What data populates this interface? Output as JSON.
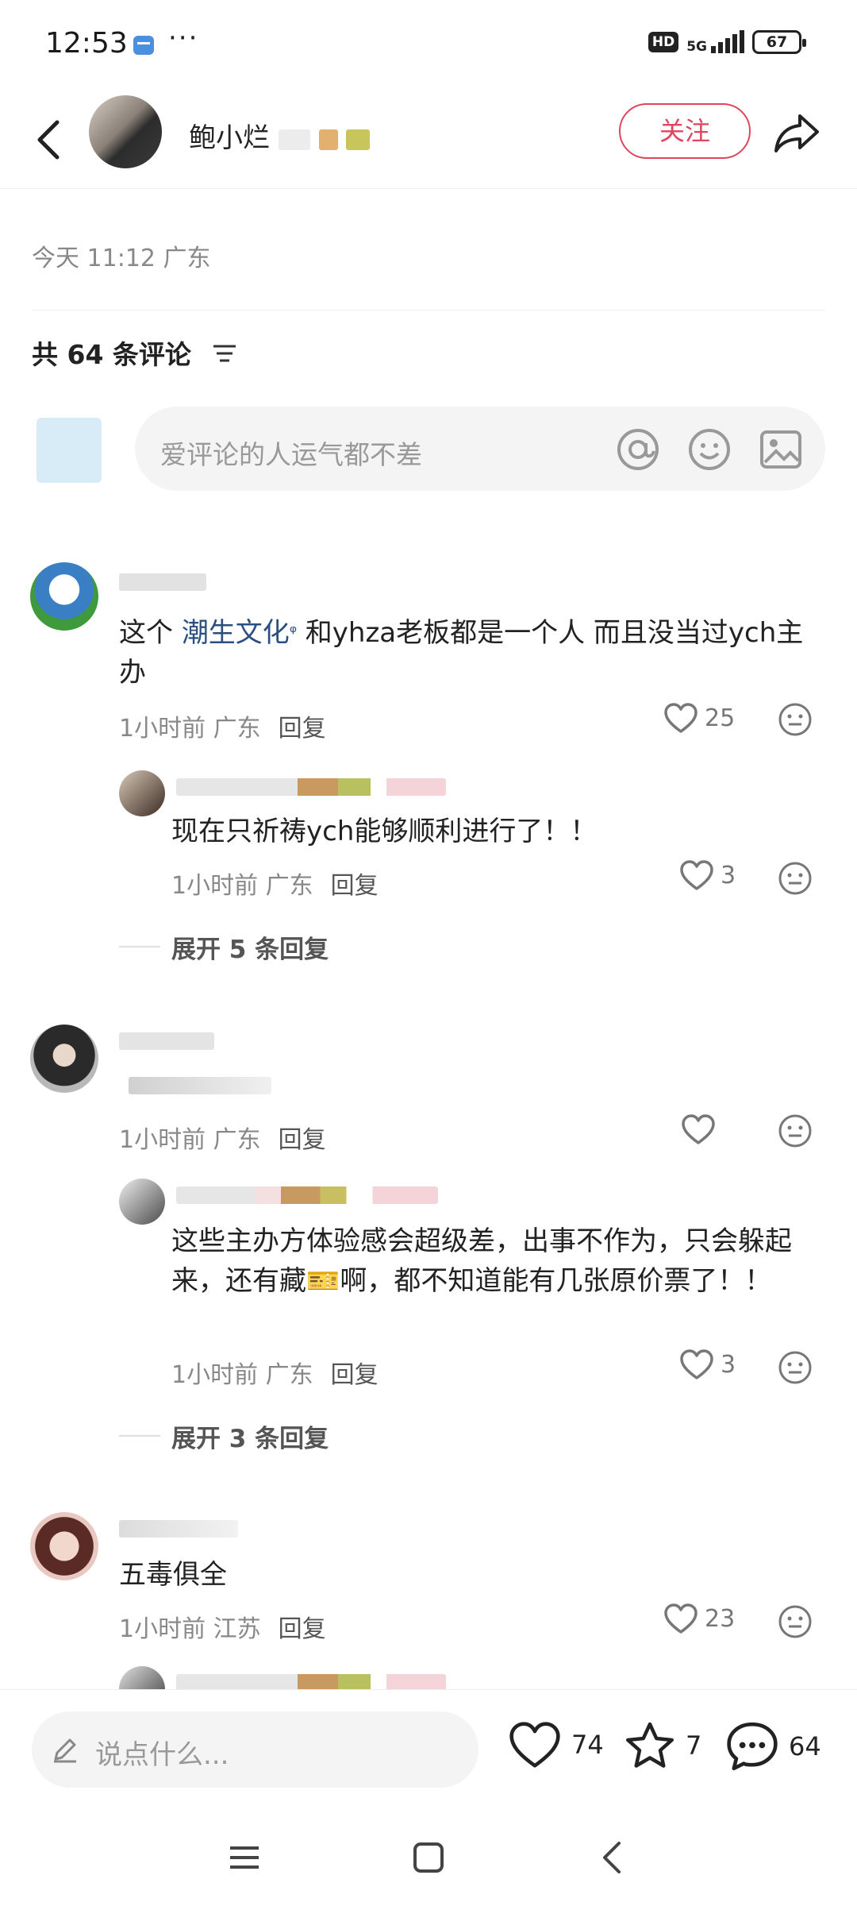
{
  "status": {
    "time": "12:53",
    "more": "···",
    "hd": "HD",
    "network": "5G",
    "battery": "67"
  },
  "header": {
    "author": "鲍小烂",
    "follow_label": "关注"
  },
  "post": {
    "time_location": "今天 11:12 广东"
  },
  "comments_header": {
    "title": "共 64 条评论"
  },
  "comment_input": {
    "placeholder": "爱评论的人运气都不差"
  },
  "comments": [
    {
      "text_before": "这个 ",
      "link": "潮生文化",
      "text_after": " 和yhza老板都是一个人 而且没当过ych主办",
      "meta": "1小时前 广东",
      "reply_label": "回复",
      "likes": "25",
      "replies": [
        {
          "text": "现在只祈祷ych能够顺利进行了！！",
          "meta": "1小时前 广东",
          "reply_label": "回复",
          "likes": "3"
        }
      ],
      "expand_label": "展开 5 条回复"
    },
    {
      "text": "",
      "meta": "1小时前 广东",
      "reply_label": "回复",
      "likes": "",
      "replies": [
        {
          "text": "这些主办方体验感会超级差，出事不作为，只会躲起来，还有藏🎫啊，都不知道能有几张原价票了！！",
          "meta": "1小时前 广东",
          "reply_label": "回复",
          "likes": "3"
        }
      ],
      "expand_label": "展开 3 条回复"
    },
    {
      "text": "五毒俱全",
      "meta": "1小时前 江苏",
      "reply_label": "回复",
      "likes": "23"
    }
  ],
  "bottom_bar": {
    "say_placeholder": "说点什么...",
    "likes": "74",
    "stars": "7",
    "comments": "64"
  },
  "colors": {
    "accent": "#e0455e",
    "link": "#2b4f80",
    "muted": "#888888"
  }
}
